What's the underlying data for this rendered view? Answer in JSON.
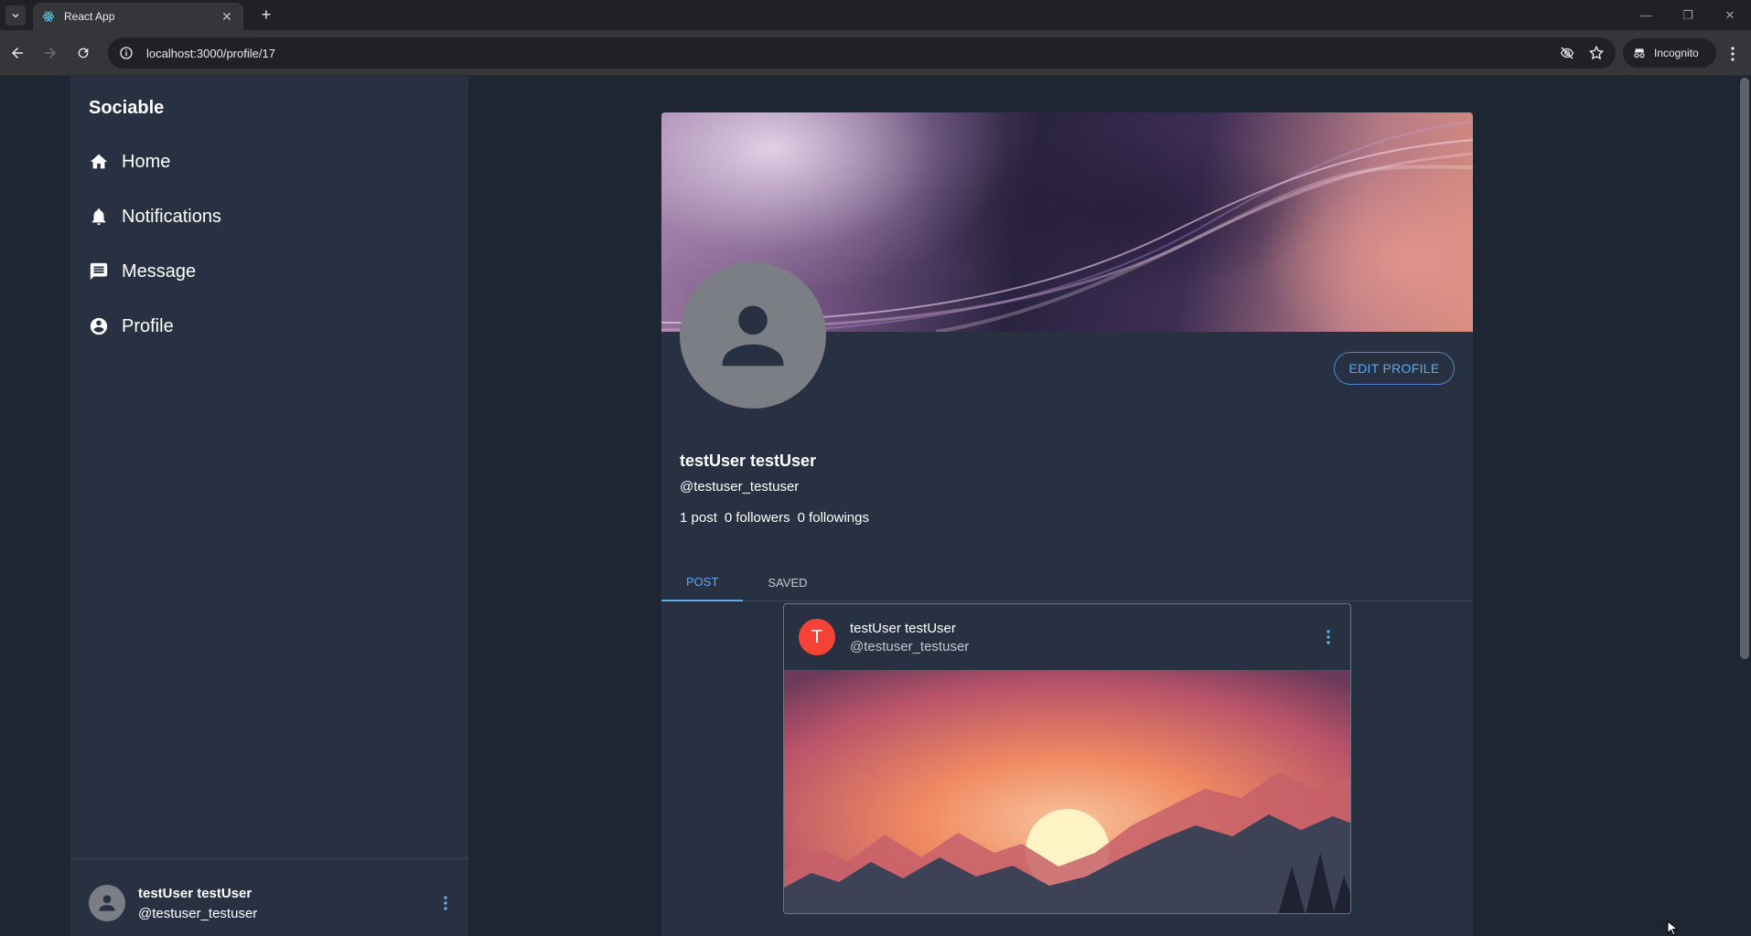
{
  "browser": {
    "tab_title": "React App",
    "url": "localhost:3000/profile/17",
    "incognito_label": "Incognito"
  },
  "sidebar": {
    "brand": "Sociable",
    "items": [
      {
        "label": "Home",
        "icon": "home-icon"
      },
      {
        "label": "Notifications",
        "icon": "bell-icon"
      },
      {
        "label": "Message",
        "icon": "message-icon"
      },
      {
        "label": "Profile",
        "icon": "account-circle-icon"
      }
    ],
    "account": {
      "name": "testUser testUser",
      "handle": "@testuser_testuser"
    }
  },
  "profile": {
    "name": "testUser testUser",
    "handle": "@testuser_testuser",
    "stats": {
      "posts": "1 post",
      "followers": "0 followers",
      "followings": "0 followings"
    },
    "edit_button": "EDIT PROFILE",
    "tabs": [
      {
        "label": "POST",
        "active": true
      },
      {
        "label": "SAVED",
        "active": false
      }
    ]
  },
  "post": {
    "avatar_letter": "T",
    "author_name": "testUser testUser",
    "author_handle": "@testuser_testuser"
  },
  "colors": {
    "background": "#1e2633",
    "panel": "#283141",
    "accent": "#5aaaf0",
    "post_avatar": "#f44336"
  }
}
